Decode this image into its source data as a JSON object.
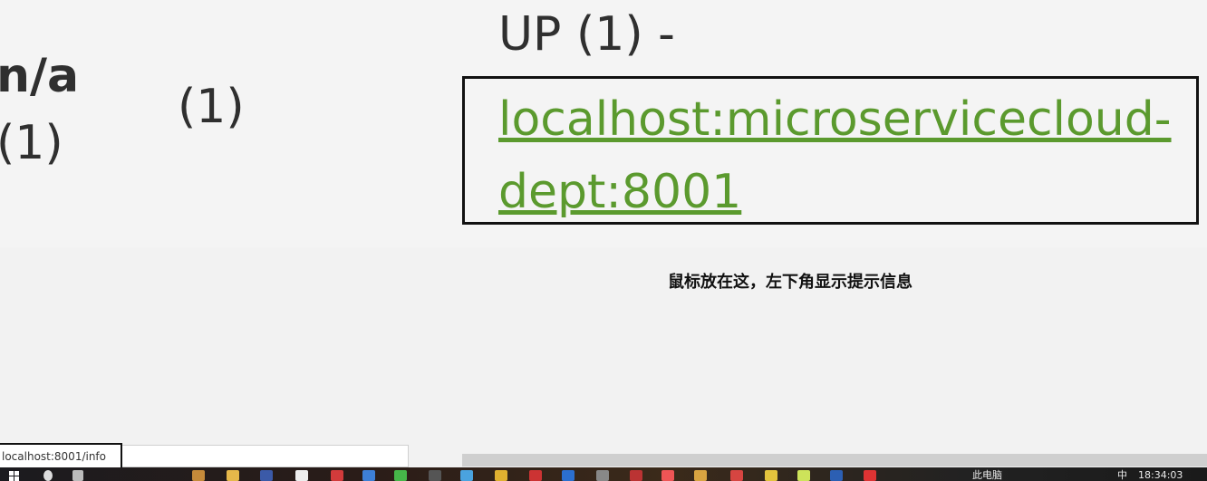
{
  "table": {
    "app_name": "n/a",
    "az_count": "(1)",
    "availability_count": "(1)",
    "status_prefix": "UP (1) -",
    "instance_link": "localhost:microservicecloud-dept:8001"
  },
  "caption": "鼠标放在这，左下角显示提示信息",
  "status_bar": {
    "url": "localhost:8001/info"
  },
  "taskbar": {
    "tray_label": "此电脑",
    "clock": "18:34:03",
    "ime": "中"
  }
}
